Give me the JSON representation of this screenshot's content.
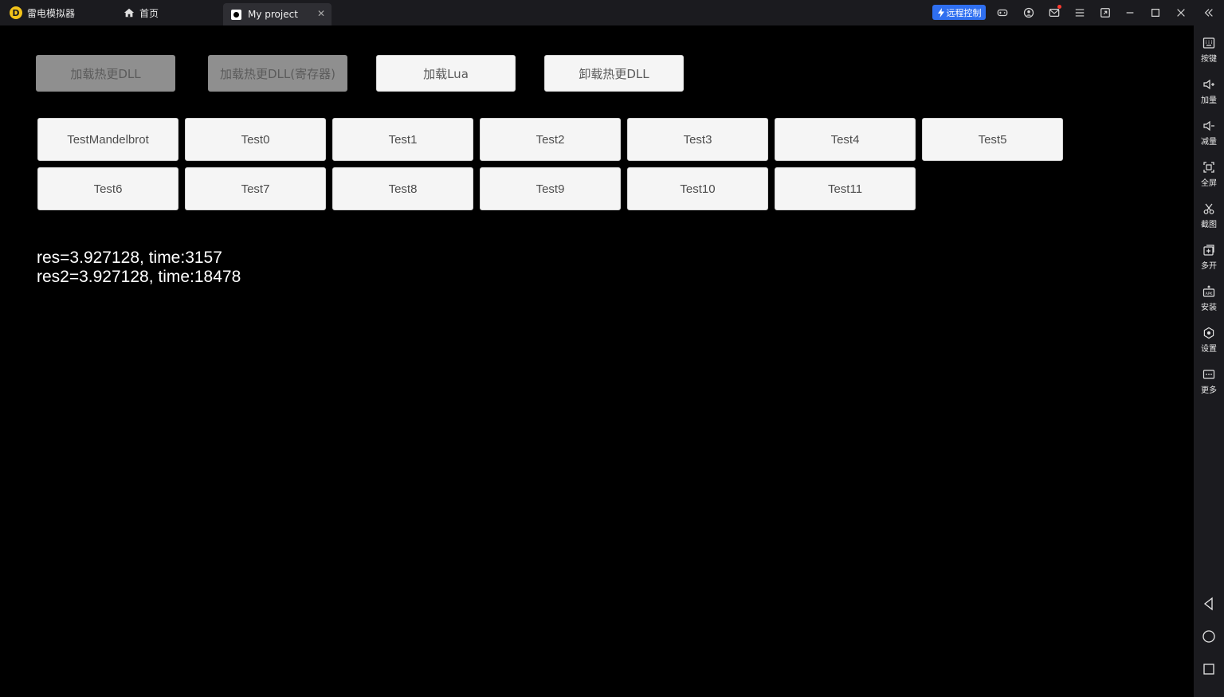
{
  "titlebar": {
    "app_name": "雷电模拟器",
    "home_tab": "首页",
    "project_tab": "My project",
    "remote_label": "远程控制"
  },
  "top_buttons": [
    {
      "label": "加载热更DLL",
      "state": "disabled"
    },
    {
      "label": "加载热更DLL(寄存器)",
      "state": "disabled"
    },
    {
      "label": "加载Lua",
      "state": "enabled"
    },
    {
      "label": "卸载热更DLL",
      "state": "enabled"
    }
  ],
  "test_buttons": [
    "TestMandelbrot",
    "Test0",
    "Test1",
    "Test2",
    "Test3",
    "Test4",
    "Test5",
    "Test6",
    "Test7",
    "Test8",
    "Test9",
    "Test10",
    "Test11"
  ],
  "results": {
    "line1": "res=3.927128, time:3157",
    "line2": "res2=3.927128, time:18478"
  },
  "sidebar": {
    "items": [
      "按键",
      "加量",
      "减量",
      "全屏",
      "截图",
      "多开",
      "安装",
      "设置",
      "更多"
    ]
  },
  "colors": {
    "accent": "#2f6ff0",
    "titlebar_bg": "#1b1b1f",
    "logo": "#f3c319"
  }
}
